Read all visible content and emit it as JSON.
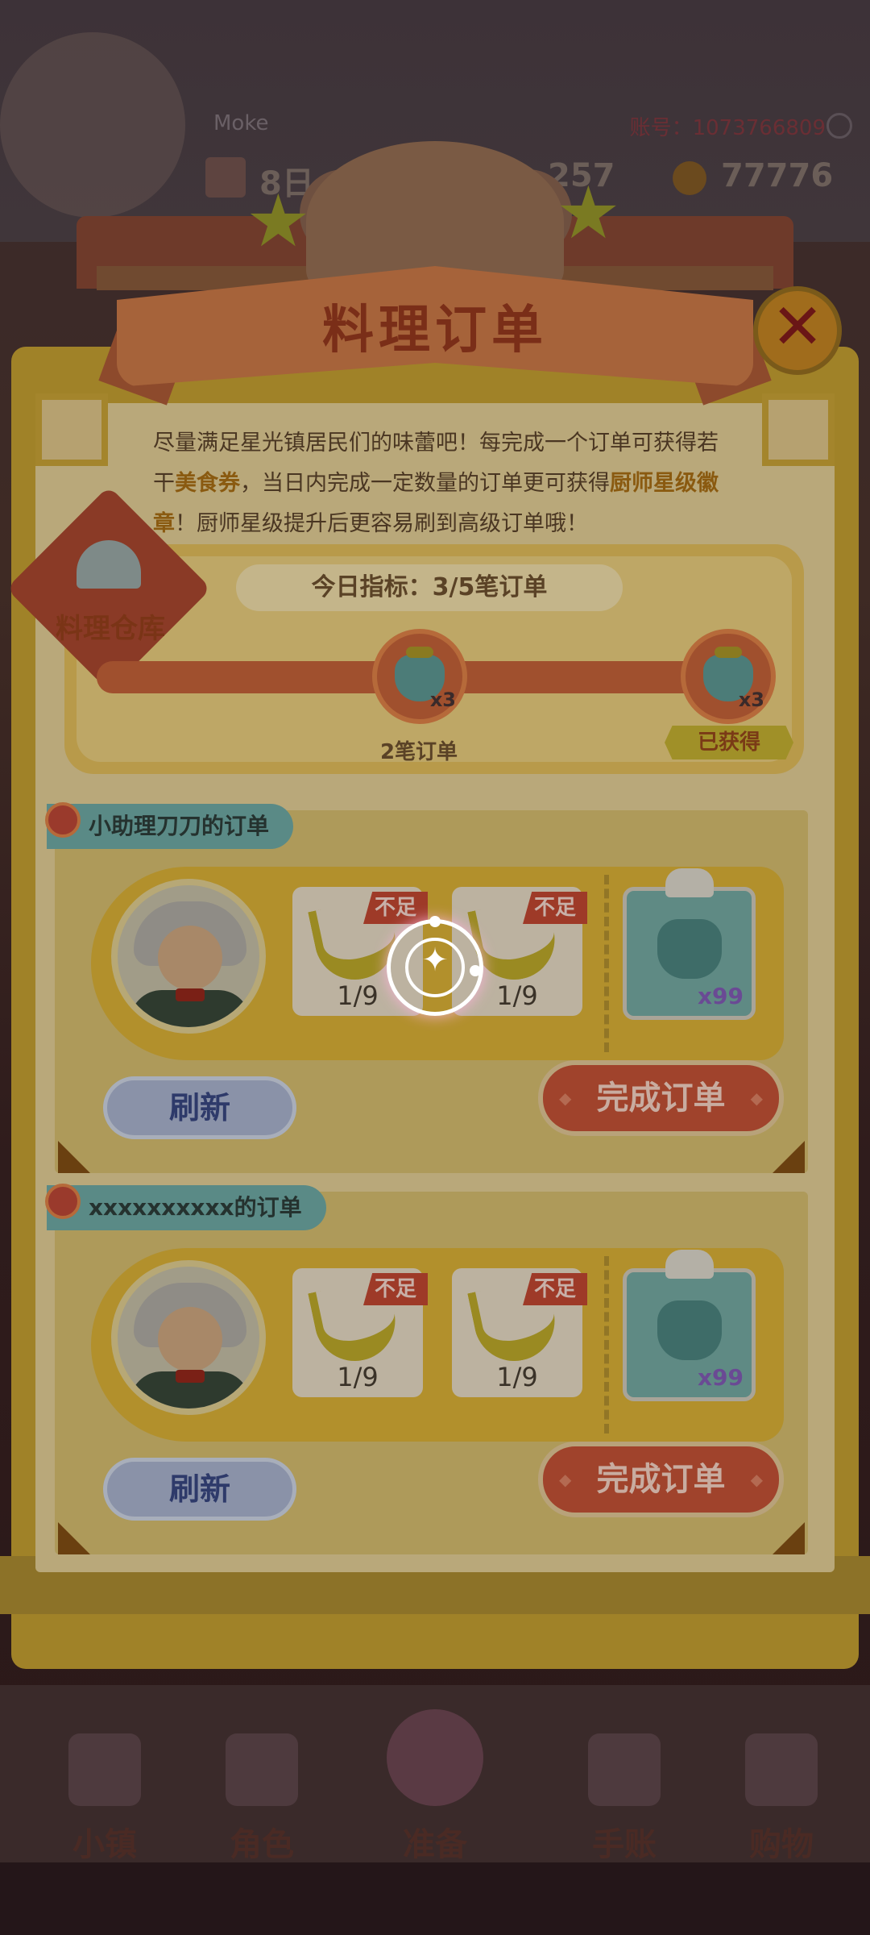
{
  "background": {
    "player_name": "Moke",
    "account": "账号：1073766809",
    "stat_day": "8日",
    "stat_mid": "257",
    "stat_coins": "77776",
    "nav": [
      {
        "label": "小镇",
        "icon": "map-icon"
      },
      {
        "label": "角色",
        "icon": "character-icon"
      },
      {
        "label": "准备",
        "icon": "prepare-icon"
      },
      {
        "label": "手账",
        "icon": "journal-icon"
      },
      {
        "label": "购物",
        "icon": "shopping-bag-icon"
      }
    ]
  },
  "dialog": {
    "title": "料理订单",
    "intro_parts": {
      "p1": "尽量满足星光镇居民们的味蕾吧！每完成一个订单可获得若干",
      "h1": "美食券",
      "p2": "，当日内完成一定数量的订单更可获得",
      "h2": "厨师星级徽章",
      "p3": "！厨师星级提升后更容易刷到高级订单哦！"
    },
    "warehouse_label": "料理仓库",
    "daily_target": "今日指标：3/5笔订单",
    "milestones": [
      {
        "qty": "x3",
        "label": "2笔订单"
      },
      {
        "qty": "x3",
        "status": "已获得"
      }
    ]
  },
  "orders": [
    {
      "title": "小助理刀刀的订单",
      "items": [
        {
          "count": "1/9",
          "tag": "不足"
        },
        {
          "count": "1/9",
          "tag": "不足"
        }
      ],
      "reward_qty": "x99",
      "refresh_label": "刷新",
      "complete_label": "完成订单"
    },
    {
      "title": "xxxxxxxxxx的订单",
      "items": [
        {
          "count": "1/9",
          "tag": "不足"
        },
        {
          "count": "1/9",
          "tag": "不足"
        }
      ],
      "reward_qty": "x99",
      "refresh_label": "刷新",
      "complete_label": "完成订单"
    }
  ],
  "colors": {
    "accent_orange": "#a0432c",
    "highlight": "#8a5a10",
    "tag_teal": "#5a8a86"
  }
}
